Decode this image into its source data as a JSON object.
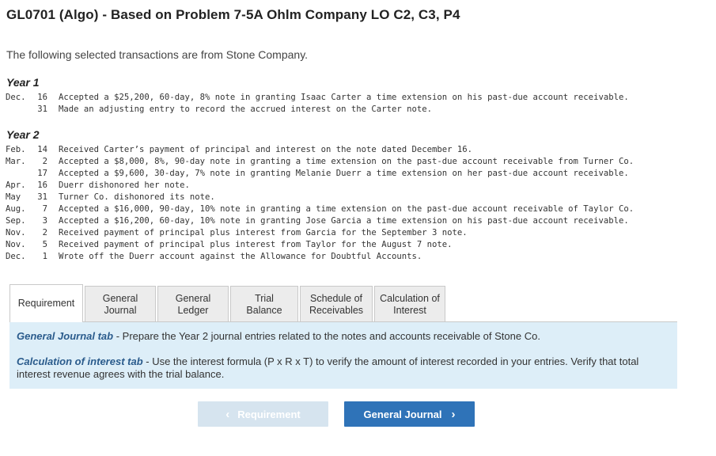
{
  "header": {
    "title": "GL0701 (Algo) - Based on Problem 7-5A Ohlm Company LO C2, C3, P4"
  },
  "intro": "The following selected transactions are from Stone Company.",
  "year1": {
    "label": "Year 1",
    "transactions": [
      {
        "month": "Dec.",
        "day": "16",
        "text": "Accepted a $25,200, 60-day, 8% note in granting Isaac Carter a time extension on his past-due account receivable."
      },
      {
        "month": "",
        "day": "31",
        "text": "Made an adjusting entry to record the accrued interest on the Carter note."
      }
    ]
  },
  "year2": {
    "label": "Year 2",
    "transactions": [
      {
        "month": "Feb.",
        "day": "14",
        "text": "Received Carter’s payment of principal and interest on the note dated December 16."
      },
      {
        "month": "Mar.",
        "day": "2",
        "text": "Accepted a $8,000, 8%, 90-day note in granting a time extension on the past-due account receivable from Turner Co."
      },
      {
        "month": "",
        "day": "17",
        "text": "Accepted a $9,600, 30-day, 7% note in granting Melanie Duerr a time extension on her past-due account receivable."
      },
      {
        "month": "Apr.",
        "day": "16",
        "text": "Duerr dishonored her note."
      },
      {
        "month": "May",
        "day": "31",
        "text": "Turner Co. dishonored its note."
      },
      {
        "month": "Aug.",
        "day": "7",
        "text": "Accepted a $16,000, 90-day, 10% note in granting a time extension on the past-due account receivable of Taylor Co."
      },
      {
        "month": "Sep.",
        "day": "3",
        "text": "Accepted a $16,200, 60-day, 10% note in granting Jose Garcia a time extension on his past-due account receivable."
      },
      {
        "month": "Nov.",
        "day": "2",
        "text": "Received payment of principal plus interest from Garcia for the September 3 note."
      },
      {
        "month": "Nov.",
        "day": "5",
        "text": "Received payment of principal plus interest from Taylor for the August 7 note."
      },
      {
        "month": "Dec.",
        "day": "1",
        "text": "Wrote off the Duerr account against the Allowance for Doubtful Accounts."
      }
    ]
  },
  "tabs": [
    {
      "line1": "Requirement",
      "line2": ""
    },
    {
      "line1": "General",
      "line2": "Journal"
    },
    {
      "line1": "General",
      "line2": "Ledger"
    },
    {
      "line1": "Trial Balance",
      "line2": ""
    },
    {
      "line1": "Schedule of",
      "line2": "Receivables"
    },
    {
      "line1": "Calculation of",
      "line2": "Interest"
    }
  ],
  "info": {
    "gj_label": "General Journal tab",
    "gj_text": " - Prepare the Year 2 journal entries related to the notes and accounts receivable of Stone Co.",
    "ci_label": "Calculation of interest tab",
    "ci_text": " - Use the interest formula (P x R x T) to verify the amount of interest recorded in your entries. Verify that total interest revenue agrees with the trial balance."
  },
  "nav": {
    "prev_label": "Requirement",
    "next_label": "General Journal",
    "prev_icon": "chevron-left-icon",
    "next_icon": "chevron-right-icon"
  },
  "colors": {
    "accent": "#2f73b8",
    "info_bg": "#ddeef8",
    "label_blue": "#2a5b8c",
    "disabled_btn": "#d6e4ef"
  }
}
